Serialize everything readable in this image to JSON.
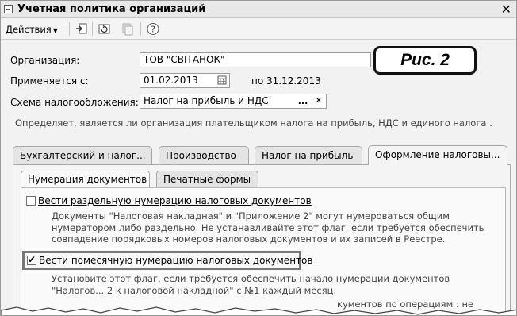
{
  "window": {
    "title": "Учетная политика организаций",
    "close_glyph": "✕"
  },
  "toolbar": {
    "actions_label": "Действия",
    "buttons": [
      {
        "icon": "import-icon"
      },
      {
        "icon": "refresh-icon"
      },
      {
        "icon": "copy-icon"
      },
      {
        "icon": "help-icon"
      }
    ]
  },
  "caption": "Рис. 2",
  "form": {
    "organization_label": "Организация:",
    "organization_value": "ТОВ \"СВІТАНОК\"",
    "applies_from_label": "Применяется с:",
    "applies_from_value": "01.02.2013",
    "applies_to_text": "по 31.12.2013",
    "tax_scheme_label": "Схема налогообложения:",
    "tax_scheme_value": "Налог на прибыль и НДС",
    "tax_scheme_select_glyph": "...",
    "tax_scheme_clear_glyph": "✕",
    "hint": "Определяет, является ли организация плательщиком налога на прибыль, НДС и единого налога ."
  },
  "tabs": [
    {
      "label": "Бухгалтерский  и налог...",
      "active": false
    },
    {
      "label": "Производство",
      "active": false
    },
    {
      "label": "Налог на прибыль",
      "active": false
    },
    {
      "label": "Оформление налоговы...",
      "active": true
    }
  ],
  "subtabs": [
    {
      "label": "Нумерация документов",
      "active": true
    },
    {
      "label": "Печатные формы",
      "active": false
    }
  ],
  "options": [
    {
      "label": "Вести раздельную нумерацию налоговых документов",
      "checked": false,
      "description": [
        "Документы \"Налоговая накладная\" и \"Приложение 2\" могут нумероваться общим",
        "нумератором либо  раздельно. Не устанавливайте этот флаг, если требуется обеспечить",
        "совпадение порядковых номеров налоговых документов и их записей в Реестре."
      ]
    },
    {
      "label": "Вести помесячную нумерацию налоговых документов",
      "checked": true,
      "description": [
        "Установите этот флаг, если требуется обеспечить начало нумерации документов",
        "\"Налогов... 2 к налоговой накладной\" с №1 каждый месяц."
      ]
    }
  ],
  "cut_off_line": "кументов по операциям : не"
}
